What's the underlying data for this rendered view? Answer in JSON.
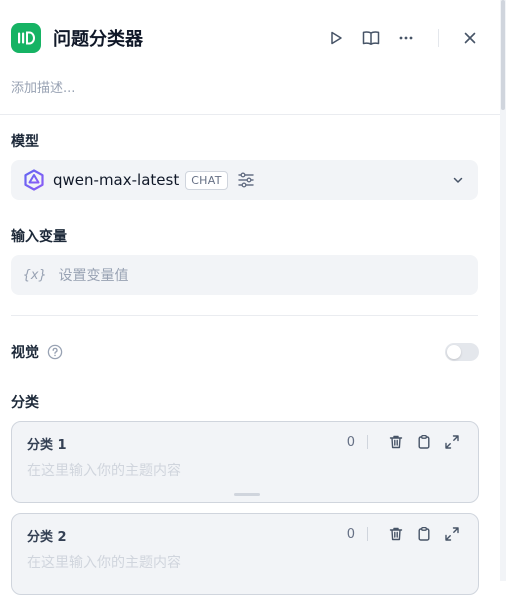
{
  "header": {
    "title": "问题分类器",
    "icon": "classifier-icon",
    "accent": "#16b364",
    "actions": [
      "play-icon",
      "book-icon",
      "more-icon",
      "close-icon"
    ]
  },
  "description_placeholder": "添加描述...",
  "model": {
    "label": "模型",
    "name": "qwen-max-latest",
    "badge": "CHAT"
  },
  "input_variable": {
    "label": "输入变量",
    "icon_text": "{x}",
    "placeholder": "设置变量值"
  },
  "vision": {
    "label": "视觉",
    "enabled": false
  },
  "classes": {
    "label": "分类",
    "items": [
      {
        "title": "分类 1",
        "count": "0",
        "placeholder": "在这里输入你的主题内容"
      },
      {
        "title": "分类 2",
        "count": "0",
        "placeholder": "在这里输入你的主题内容"
      }
    ]
  }
}
